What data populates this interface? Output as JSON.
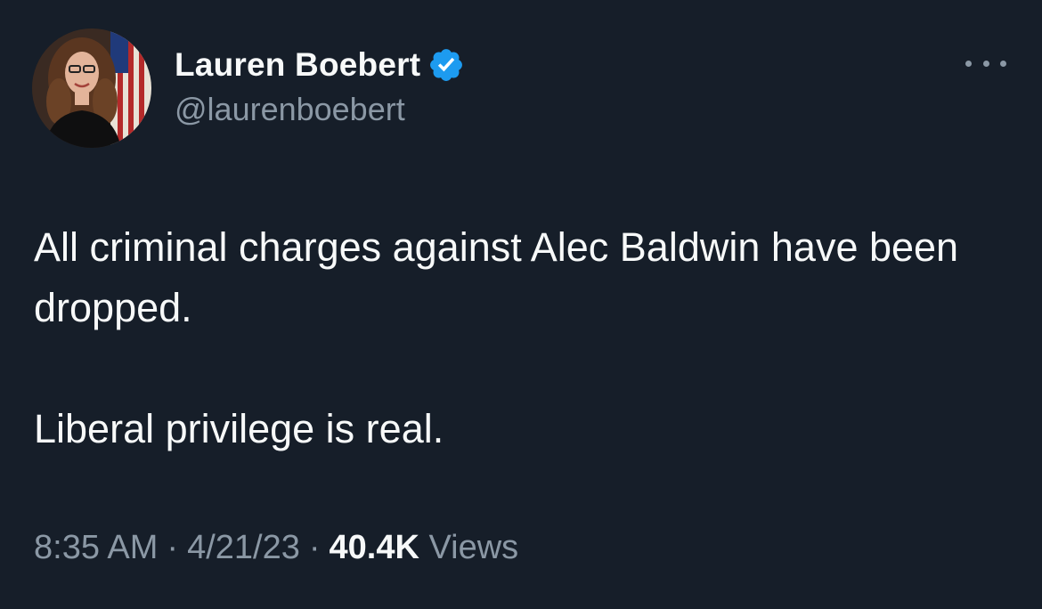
{
  "tweet": {
    "author": {
      "display_name": "Lauren Boebert",
      "handle": "@laurenboebert",
      "verified": true,
      "verified_icon": "verified-badge-icon",
      "avatar_icon": "profile-photo"
    },
    "more_icon": "more-options-icon",
    "text": {
      "paragraph1": "All criminal charges against Alec Baldwin have been dropped.",
      "paragraph2": "Liberal privilege is real."
    },
    "meta": {
      "time": "8:35 AM",
      "separator": "·",
      "date": "4/21/23",
      "views_count": "40.4K",
      "views_label": "Views"
    }
  },
  "colors": {
    "background": "#15202b",
    "primary_text": "#f7f9f9",
    "secondary_text": "#8b98a5",
    "verified_blue": "#1d9bf0"
  }
}
